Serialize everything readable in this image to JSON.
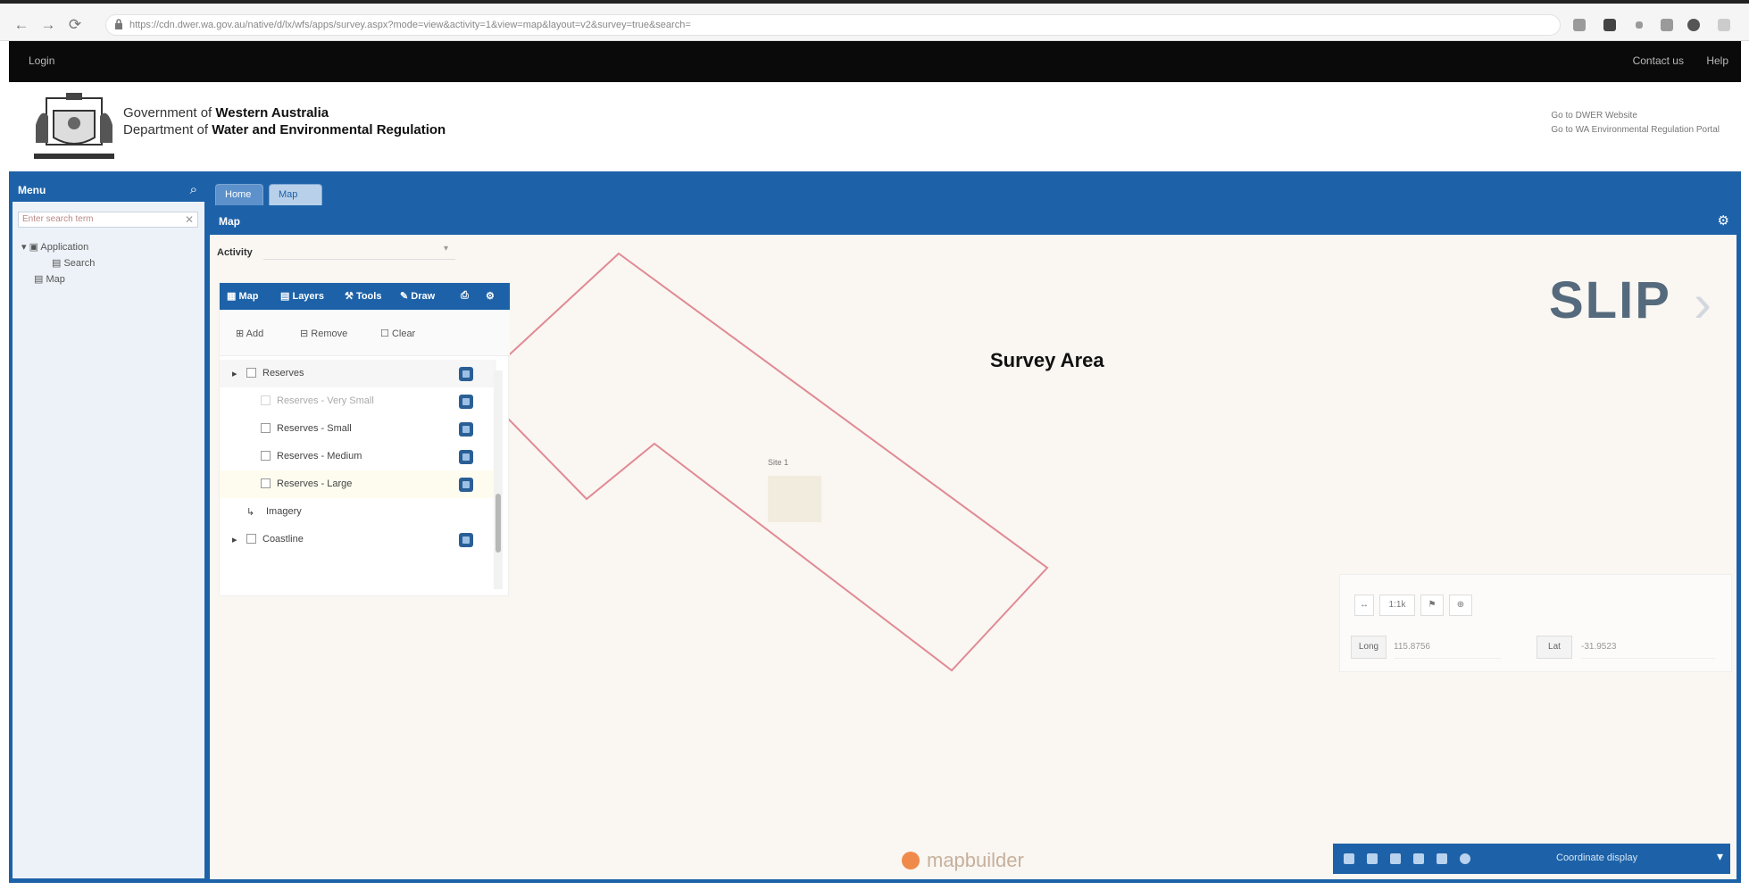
{
  "browser": {
    "url": "https://cdn.dwer.wa.gov.au/native/d/lx/wfs/apps/survey.aspx?mode=view&activity=1&view=map&layout=v2&survey=true&search=",
    "nav": [
      "←",
      "→",
      "⟳"
    ]
  },
  "topbar": {
    "login": "Login",
    "links": [
      "Contact us",
      "Help"
    ]
  },
  "header": {
    "gov_prefix": "Government of ",
    "gov_name": "Western Australia",
    "dept_prefix": "Department of ",
    "dept_name": "Water and Environmental Regulation",
    "links": [
      "Go to DWER Website",
      "Go to WA Environmental Regulation Portal"
    ]
  },
  "left_panel": {
    "title": "Menu",
    "search_placeholder": "Enter search term",
    "tree": [
      "Application",
      "Search",
      "Map"
    ]
  },
  "tabs": [
    "Home",
    "Map"
  ],
  "map": {
    "title": "Map",
    "activity_label": "Activity",
    "survey_label": "Survey Area",
    "polygon_label": "Site 1"
  },
  "layer_panel": {
    "toolbar": [
      "Map",
      "Layers",
      "Tools",
      "Draw"
    ],
    "actions": [
      "Add",
      "Remove",
      "Clear"
    ],
    "rows": [
      {
        "label": "Reserves"
      },
      {
        "label": "Reserves - Very Small"
      },
      {
        "label": "Reserves - Small"
      },
      {
        "label": "Reserves - Medium"
      },
      {
        "label": "Reserves - Large"
      },
      {
        "label": "Imagery"
      },
      {
        "label": "Coastline"
      }
    ]
  },
  "coords": {
    "long_label": "Long",
    "long_value": "115.8756",
    "lat_label": "Lat",
    "lat_value": "-31.9523",
    "buttons": [
      "↔",
      "1:1k",
      "⚑",
      "⊕"
    ]
  },
  "map_bottom": {
    "text": "Coordinate display"
  },
  "powered_by": "mapbuilder",
  "slip_logo": "SLIP",
  "colors": {
    "primary": "#1d62a8",
    "polygon_stroke": "#e08a94"
  }
}
